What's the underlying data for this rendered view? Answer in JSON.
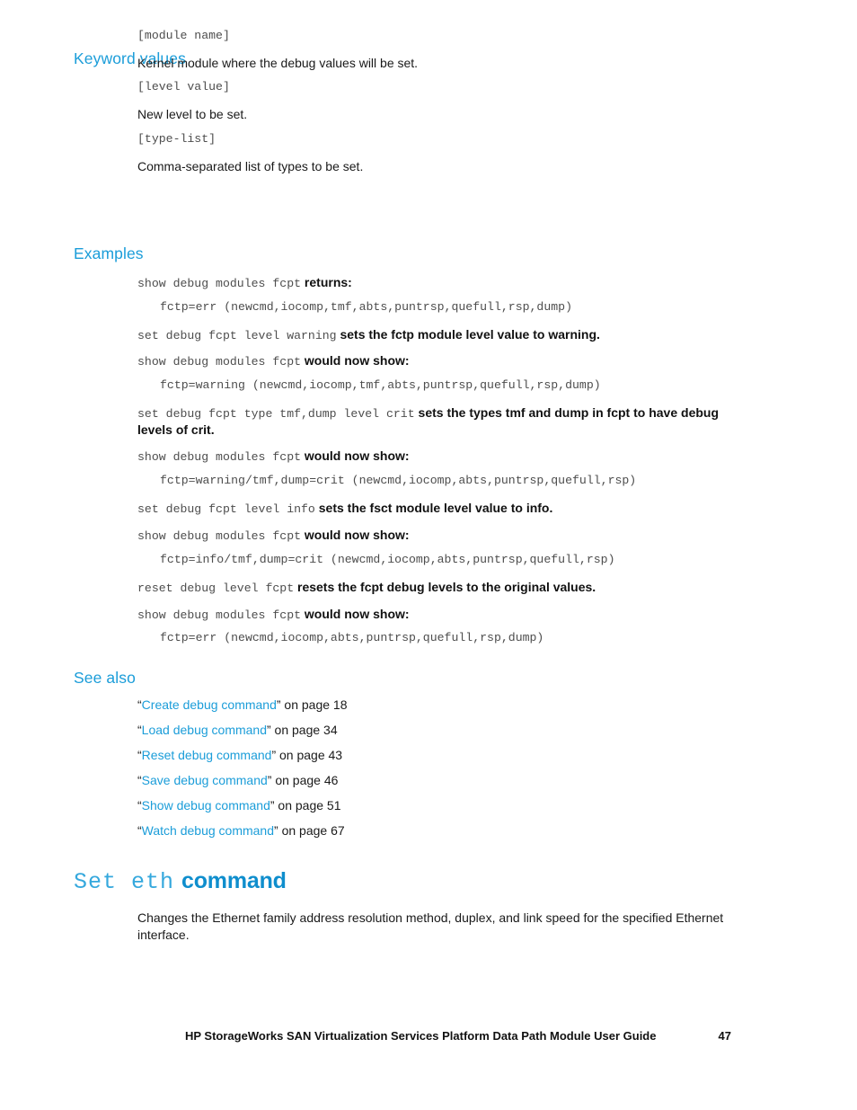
{
  "document": {
    "page_number": "47",
    "footer_title": "HP StorageWorks SAN Virtualization Services Platform Data Path Module User Guide",
    "accent_color": "#1b9dd9",
    "code_color": "#4d4d4d"
  },
  "keyword_values": {
    "heading": "Keyword values",
    "entries": [
      {
        "term": "[module name]",
        "description": "Kernel module where the debug values will be set."
      },
      {
        "term": "[level value]",
        "description": "New level to be set."
      },
      {
        "term": "[type-list]",
        "description": "Comma-separated list of types to be set."
      }
    ]
  },
  "examples": {
    "heading": "Examples",
    "lines": [
      {
        "kind": "mixed",
        "indent": false,
        "code": "show debug modules fcpt",
        "text": " returns:"
      },
      {
        "kind": "code",
        "indent": true,
        "code": "fctp=err (newcmd,iocomp,tmf,abts,puntrsp,quefull,rsp,dump)"
      },
      {
        "kind": "mixed",
        "indent": false,
        "code": "set debug fcpt level warning",
        "text": " sets the fctp module level value to warning."
      },
      {
        "kind": "mixed",
        "indent": false,
        "code": "show debug modules fcpt",
        "text": " would now show:"
      },
      {
        "kind": "code",
        "indent": true,
        "code": "fctp=warning (newcmd,iocomp,tmf,abts,puntrsp,quefull,rsp,dump)"
      },
      {
        "kind": "mixed",
        "indent": false,
        "code": "set debug fcpt type tmf,dump level crit",
        "text": " sets the types tmf and dump in fcpt to have debug levels of crit."
      },
      {
        "kind": "mixed",
        "indent": false,
        "code": "show debug modules fcpt",
        "text": " would now show:"
      },
      {
        "kind": "code",
        "indent": true,
        "code": "fctp=warning/tmf,dump=crit (newcmd,iocomp,abts,puntrsp,quefull,rsp)"
      },
      {
        "kind": "mixed",
        "indent": false,
        "code": "set debug fcpt level info",
        "text": " sets the fsct module level value to info."
      },
      {
        "kind": "mixed",
        "indent": false,
        "code": "show debug modules fcpt",
        "text": " would now show:"
      },
      {
        "kind": "code",
        "indent": true,
        "code": "fctp=info/tmf,dump=crit (newcmd,iocomp,abts,puntrsp,quefull,rsp)"
      },
      {
        "kind": "mixed",
        "indent": false,
        "code": "reset debug level fcpt",
        "text": " resets the fcpt debug levels to the original values."
      },
      {
        "kind": "mixed",
        "indent": false,
        "code": "show debug modules fcpt",
        "text": " would now show:"
      },
      {
        "kind": "code",
        "indent": true,
        "code": "fctp=err (newcmd,iocomp,abts,puntrsp,quefull,rsp,dump)"
      }
    ]
  },
  "see_also": {
    "heading": "See also",
    "links": [
      {
        "open_quote": "“",
        "label": "Create debug command",
        "close_quote": "”",
        "suffix": " on page 18"
      },
      {
        "open_quote": "“",
        "label": "Load debug command",
        "close_quote": "”",
        "suffix": " on page 34"
      },
      {
        "open_quote": "“",
        "label": "Reset debug command",
        "close_quote": "”",
        "suffix": " on page 43"
      },
      {
        "open_quote": "“",
        "label": "Save debug command",
        "close_quote": "”",
        "suffix": " on page 46"
      },
      {
        "open_quote": "“",
        "label": "Show debug command",
        "close_quote": "”",
        "suffix": " on page 51"
      },
      {
        "open_quote": "“",
        "label": "Watch debug command",
        "close_quote": "”",
        "suffix": " on page 67"
      }
    ]
  },
  "set_eth": {
    "heading_mono": "Set eth",
    "heading_word": "command",
    "description": "Changes the Ethernet family address resolution method, duplex, and link speed for the specified Ethernet interface."
  }
}
